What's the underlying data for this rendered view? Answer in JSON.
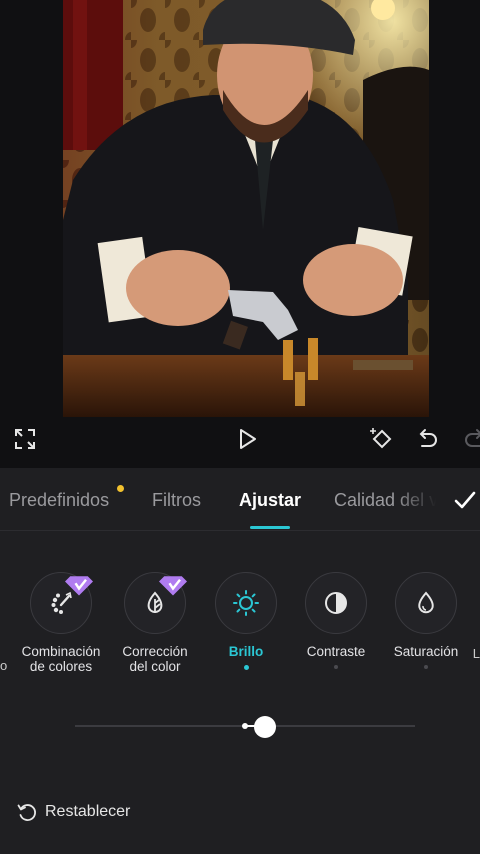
{
  "toolbar": {
    "fullscreen_icon": "expand-icon",
    "play_icon": "play-icon",
    "keyframe_icon": "keyframe-icon",
    "undo_icon": "undo-icon",
    "redo_icon": "redo-icon"
  },
  "tabs": [
    {
      "label": "Predefinidos",
      "has_dot": true
    },
    {
      "label": "Filtros"
    },
    {
      "label": "Ajustar",
      "active": true
    },
    {
      "label": "Calidad del v"
    }
  ],
  "tools": [
    {
      "label_line1": "Combinación",
      "label_line2": "de colores",
      "icon": "color-combination-icon",
      "premium": true
    },
    {
      "label_line1": "Corrección",
      "label_line2": "del color",
      "icon": "color-correction-icon",
      "premium": true
    },
    {
      "label_line1": "Brillo",
      "label_line2": "",
      "icon": "brightness-icon",
      "active": true
    },
    {
      "label_line1": "Contraste",
      "label_line2": "",
      "icon": "contrast-icon"
    },
    {
      "label_line1": "Saturación",
      "label_line2": "",
      "icon": "saturation-icon"
    }
  ],
  "slider": {
    "value_fraction": 0.56,
    "zero_fraction": 0.5
  },
  "reset_label": "Restablecer",
  "colors": {
    "accent": "#2bc7d4",
    "dot": "#f2c12e",
    "premium": "#b07cf0"
  }
}
